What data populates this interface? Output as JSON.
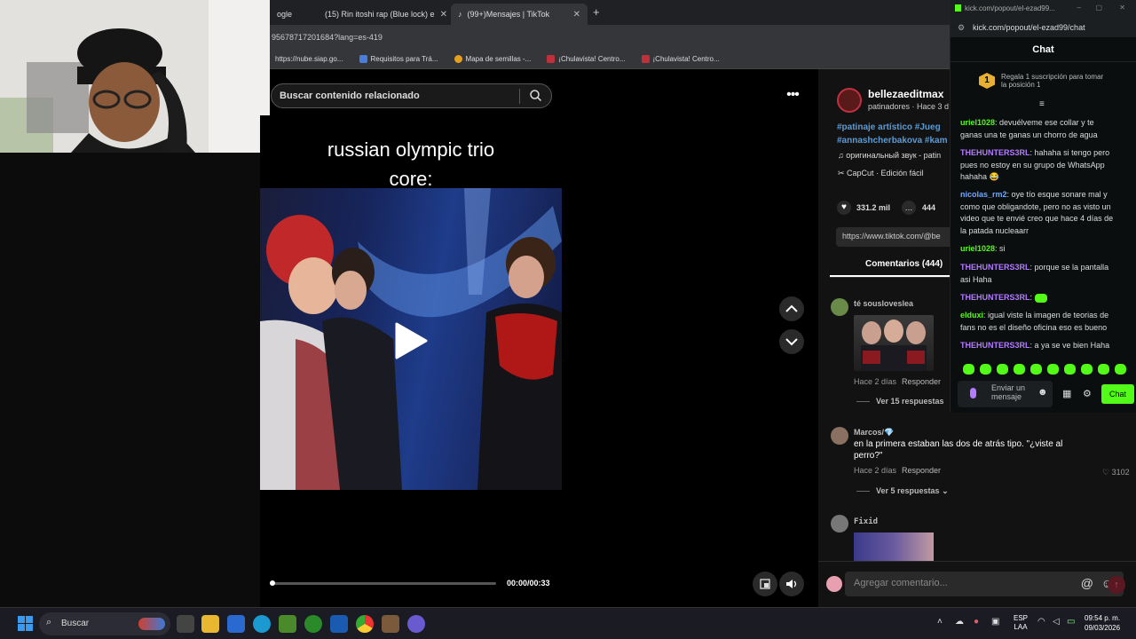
{
  "browser": {
    "tabs": [
      {
        "label": "ogle"
      },
      {
        "label": "(15) Rin itoshi rap (Blue lock) e"
      },
      {
        "label": "(99+)Mensajes | TikTok"
      }
    ],
    "new_tab_icon": "plus-icon",
    "url": "95678717201684?lang=es-419",
    "bookmarks": [
      "https://nube.siap.go...",
      "Requisitos para Trá...",
      "Mapa de semillas -...",
      "¡Chulavista! Centro...",
      "¡Chulavista! Centro..."
    ]
  },
  "search": {
    "placeholder": "Buscar contenido relacionado",
    "icon": "search-icon"
  },
  "video": {
    "title_line1": "russian olympic trio",
    "title_line2": "core:",
    "time": "00:00/00:33",
    "progress_fraction": 0.0
  },
  "post": {
    "username": "bellezaeditmax",
    "subline": "patinadores · Hace 3 d",
    "hashtags_line1": "#patinaje artístico #Jueg",
    "hashtags_line2": "#annashcherbakova #kam",
    "sound": "оригинальный звук - patin",
    "capcut": "CapCut · Edición fácil",
    "likes": "331.2 mil",
    "comments_count": "444",
    "link": "https://www.tiktok.com/@be",
    "comments_tab": "Comentarios (444)"
  },
  "comments": [
    {
      "user": "té sousloveslea",
      "time": "Hace 2 días",
      "reply": "Responder",
      "more": "Ver 15 respuestas"
    },
    {
      "user": "Marcos/💎",
      "text1": "en la primera estaban las dos de atrás tipo. \"¿viste al",
      "text2": "perro?\"",
      "time": "Hace 2 días",
      "reply": "Responder",
      "likes": "3102",
      "more": "Ver 5 respuestas"
    },
    {
      "user": "Fixid"
    }
  ],
  "comment_input": {
    "placeholder": "Agregar comentario..."
  },
  "kick": {
    "window_url": "kick.com/popout/el-ezad99...",
    "address": "kick.com/popout/el-ezad99/chat",
    "header": "Chat",
    "gift_rank": "1",
    "gift_text1": "Regala 1 suscripción para tomar",
    "gift_text2": "la posición 1",
    "messages": [
      {
        "user": "uriel1028",
        "text": "devuélveme ese collar y te ganas una te ganas un chorro de agua"
      },
      {
        "user": "THEHUNTERS3RL",
        "text": "hahaha si tengo pero pues no estoy en su grupo de WhatsApp hahaha 😂"
      },
      {
        "user": "nicolas_rm2",
        "text": "oye tío esque sonare mal y como que obligandote, pero no as visto un video que te envié creo que hace 4 días de la patada nucleaarr"
      },
      {
        "user": "uriel1028",
        "text": "si"
      },
      {
        "user": "THEHUNTERS3RL",
        "text": "porque se la pantalla asi Haha"
      },
      {
        "user": "THEHUNTERS3RL",
        "text": ""
      },
      {
        "user": "elduxi",
        "text": "igual viste la imagen de teorias de fans no es el diseño oficina eso es bueno"
      },
      {
        "user": "THEHUNTERS3RL",
        "text": "a ya se ve bien Haha"
      }
    ],
    "input_placeholder": "Enviar un mensaje",
    "chat_button": "Chat"
  },
  "taskbar": {
    "search": "Buscar",
    "lang1": "ESP",
    "lang2": "LAA",
    "time": "09:54 p. m.",
    "date": "09/03/2026"
  },
  "colors": {
    "kick_green": "#53fc18",
    "tiktok_red": "#fe2c55",
    "hashtag": "#5b9bd5"
  }
}
